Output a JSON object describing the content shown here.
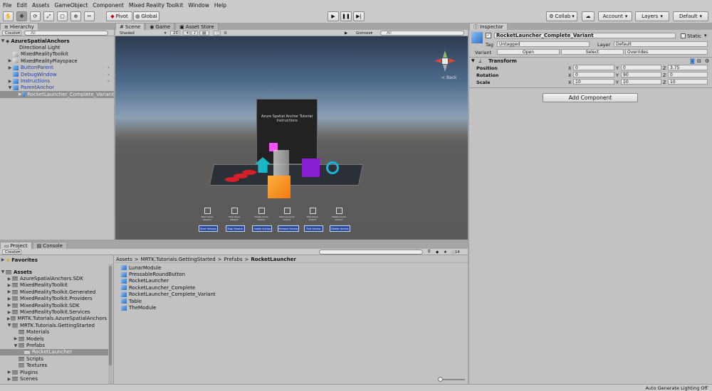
{
  "menu": [
    "File",
    "Edit",
    "Assets",
    "GameObject",
    "Component",
    "Mixed Reality Toolkit",
    "Window",
    "Help"
  ],
  "toolbar": {
    "pivot": "Pivot",
    "global": "Global",
    "collab": "Collab",
    "account": "Account",
    "layers": "Layers",
    "layout": "Default"
  },
  "hierarchy": {
    "tab": "Hierarchy",
    "create": "Create",
    "search_placeholder": "All",
    "scene": "AzureSpatialAnchors",
    "items": [
      {
        "label": "Directional Light"
      },
      {
        "label": "MixedRealityToolkit"
      },
      {
        "label": "MixedRealityPlayspace"
      },
      {
        "label": "ButtonParent"
      },
      {
        "label": "DebugWindow"
      },
      {
        "label": "Instructions"
      },
      {
        "label": "ParentAnchor"
      },
      {
        "label": "RocketLauncher_Complete_Variant"
      }
    ]
  },
  "scene": {
    "tabs": [
      "Scene",
      "Game",
      "Asset Store"
    ],
    "shading": "Shaded",
    "mode_2d": "2D",
    "gizmos": "Gizmos",
    "search_placeholder": "All",
    "fx_count": "0",
    "back_label": "Back",
    "tutorial_title": "Azure Spatial Anchor Tutorial",
    "tutorial_sub": "Instructions",
    "buttons": [
      "Start Session",
      "Stop Session",
      "Create Anchor",
      "Remove Anchor",
      "Find Anchor",
      "Delete Anchor"
    ],
    "captions": [
      "Start Azure Session",
      "Stop Azure Session",
      "Create Azure Anchor",
      "Remove Local Anchor",
      "Find Azure Anchor",
      "Delete Azure Anchor"
    ]
  },
  "inspector": {
    "tab": "Inspector",
    "object_name": "RocketLauncher_Complete_Variant",
    "static_label": "Static",
    "tag_label": "Tag",
    "tag_value": "Untagged",
    "layer_label": "Layer",
    "layer_value": "Default",
    "variant_label": "Variant",
    "open": "Open",
    "select": "Select",
    "overrides": "Overrides",
    "transform_title": "Transform",
    "rows": [
      {
        "label": "Position",
        "x": "0",
        "y": "0",
        "z": "3.75"
      },
      {
        "label": "Rotation",
        "x": "0",
        "y": "90",
        "z": "0"
      },
      {
        "label": "Scale",
        "x": "10",
        "y": "10",
        "z": "10"
      }
    ],
    "add_component": "Add Component"
  },
  "project": {
    "tabs": [
      "Project",
      "Console"
    ],
    "create": "Create",
    "filter_count": "14",
    "favorites": "Favorites",
    "assets": "Assets",
    "tree": [
      {
        "label": "AzureSpatialAnchors.SDK"
      },
      {
        "label": "MixedRealityToolkit"
      },
      {
        "label": "MixedRealityToolkit.Generated"
      },
      {
        "label": "MixedRealityToolkit.Providers"
      },
      {
        "label": "MixedRealityToolkit.SDK"
      },
      {
        "label": "MixedRealityToolkit.Services"
      },
      {
        "label": "MRTK.Tutorials.AzureSpatialAnchors"
      },
      {
        "label": "MRTK.Tutorials.GettingStarted"
      },
      {
        "label": "Materials"
      },
      {
        "label": "Models"
      },
      {
        "label": "Prefabs"
      },
      {
        "label": "RocketLauncher"
      },
      {
        "label": "Scripts"
      },
      {
        "label": "Textures"
      },
      {
        "label": "Plugins"
      },
      {
        "label": "Scenes"
      }
    ],
    "breadcrumb": [
      "Assets",
      "MRTK.Tutorials.GettingStarted",
      "Prefabs",
      "RocketLauncher"
    ],
    "files": [
      "LunarModule",
      "PressableRoundButton",
      "RocketLauncher",
      "RocketLauncher_Complete",
      "RocketLauncher_Complete_Variant",
      "Table",
      "TheModule"
    ]
  },
  "status": "Auto Generate Lighting Off"
}
